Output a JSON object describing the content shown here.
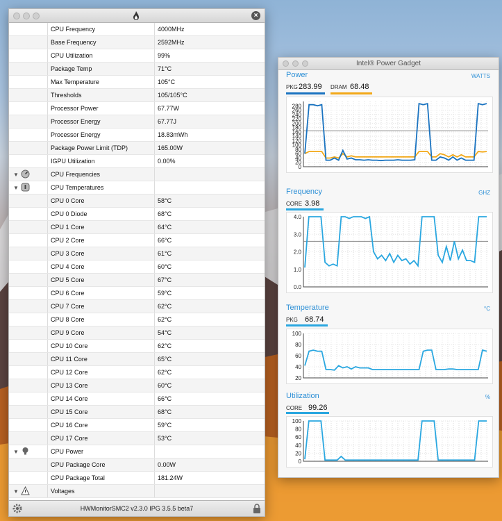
{
  "hwmonitor": {
    "footer": "HWMonitorSMC2 v2.3.0 IPG 3.5.5 beta7",
    "rows": [
      {
        "type": "item",
        "name": "CPU Frequency",
        "value": "4000MHz"
      },
      {
        "type": "item",
        "name": "Base Frequency",
        "value": "2592MHz"
      },
      {
        "type": "item",
        "name": "CPU Utilization",
        "value": "99%"
      },
      {
        "type": "item",
        "name": "Package Temp",
        "value": "71°C"
      },
      {
        "type": "item",
        "name": "Max Temperature",
        "value": "105°C"
      },
      {
        "type": "item",
        "name": "Thresholds",
        "value": "105/105°C"
      },
      {
        "type": "item",
        "name": "Processor Power",
        "value": "67.77W"
      },
      {
        "type": "item",
        "name": "Processor Energy",
        "value": "67.77J"
      },
      {
        "type": "item",
        "name": "Processor Energy",
        "value": "18.83mWh"
      },
      {
        "type": "item",
        "name": "Package Power Limit (TDP)",
        "value": "165.00W"
      },
      {
        "type": "item",
        "name": "IGPU Utilization",
        "value": "0.00%"
      },
      {
        "type": "group",
        "name": "CPU Frequencies",
        "value": "",
        "icon": "gauge-icon"
      },
      {
        "type": "group",
        "name": "CPU Temperatures",
        "value": "",
        "icon": "thermometer-icon"
      },
      {
        "type": "item",
        "name": "CPU 0 Core",
        "value": "58°C"
      },
      {
        "type": "item",
        "name": "CPU 0 Diode",
        "value": "68°C"
      },
      {
        "type": "item",
        "name": "CPU 1 Core",
        "value": "64°C"
      },
      {
        "type": "item",
        "name": "CPU 2 Core",
        "value": "66°C"
      },
      {
        "type": "item",
        "name": "CPU 3 Core",
        "value": "61°C"
      },
      {
        "type": "item",
        "name": "CPU 4 Core",
        "value": "60°C"
      },
      {
        "type": "item",
        "name": "CPU 5 Core",
        "value": "67°C"
      },
      {
        "type": "item",
        "name": "CPU 6 Core",
        "value": "59°C"
      },
      {
        "type": "item",
        "name": "CPU 7 Core",
        "value": "62°C"
      },
      {
        "type": "item",
        "name": "CPU 8 Core",
        "value": "62°C"
      },
      {
        "type": "item",
        "name": "CPU 9 Core",
        "value": "54°C"
      },
      {
        "type": "item",
        "name": "CPU 10 Core",
        "value": "62°C"
      },
      {
        "type": "item",
        "name": "CPU 11 Core",
        "value": "65°C"
      },
      {
        "type": "item",
        "name": "CPU 12 Core",
        "value": "62°C"
      },
      {
        "type": "item",
        "name": "CPU 13 Core",
        "value": "60°C"
      },
      {
        "type": "item",
        "name": "CPU 14 Core",
        "value": "66°C"
      },
      {
        "type": "item",
        "name": "CPU 15 Core",
        "value": "68°C"
      },
      {
        "type": "item",
        "name": "CPU 16 Core",
        "value": "59°C"
      },
      {
        "type": "item",
        "name": "CPU 17 Core",
        "value": "53°C"
      },
      {
        "type": "group",
        "name": "CPU Power",
        "value": "",
        "icon": "lightbulb-icon"
      },
      {
        "type": "item",
        "name": "CPU Package Core",
        "value": "0.00W"
      },
      {
        "type": "item",
        "name": "CPU Package Total",
        "value": "181.24W"
      },
      {
        "type": "group",
        "name": "Voltages",
        "value": "",
        "icon": "warning-icon"
      }
    ]
  },
  "ipg": {
    "title": "Intel® Power Gadget",
    "power": {
      "title": "Power",
      "unit": "WATTS",
      "pkg_label": "PKG",
      "pkg_value": "283.99",
      "dram_label": "DRAM",
      "dram_value": "68.48",
      "pkg_color": "#1a73c0",
      "dram_color": "#f2a818"
    },
    "frequency": {
      "title": "Frequency",
      "unit": "GHZ",
      "core_label": "CORE",
      "core_value": "3.98",
      "color": "#2aa7e0"
    },
    "temperature": {
      "title": "Temperature",
      "unit": "°C",
      "pkg_label": "PKG",
      "pkg_value": "68.74",
      "color": "#2aa7e0"
    },
    "utilization": {
      "title": "Utilization",
      "unit": "%",
      "core_label": "CORE",
      "core_value": "99.26",
      "color": "#2aa7e0"
    }
  },
  "chart_data": [
    {
      "type": "line",
      "title": "Power",
      "yticks": [
        "280",
        "260",
        "240",
        "220",
        "200",
        "180",
        "160",
        "140",
        "120",
        "100",
        "80",
        "60",
        "40",
        "20",
        "0"
      ],
      "ylim": [
        0,
        300
      ],
      "threshold": 165,
      "series": [
        {
          "name": "PKG",
          "values": [
            60,
            285,
            285,
            280,
            285,
            30,
            30,
            40,
            30,
            75,
            35,
            40,
            32,
            32,
            30,
            32,
            30,
            30,
            28,
            30,
            30,
            30,
            32,
            30,
            30,
            30,
            32,
            290,
            285,
            290,
            30,
            30,
            45,
            40,
            30,
            45,
            30,
            40,
            30,
            30,
            30,
            290,
            285,
            290
          ]
        },
        {
          "name": "DRAM",
          "values": [
            60,
            70,
            70,
            70,
            70,
            40,
            40,
            45,
            40,
            60,
            45,
            50,
            45,
            45,
            45,
            45,
            45,
            45,
            45,
            45,
            45,
            45,
            45,
            45,
            45,
            45,
            45,
            70,
            70,
            70,
            45,
            45,
            60,
            55,
            45,
            55,
            45,
            55,
            45,
            45,
            45,
            70,
            68,
            70
          ]
        }
      ]
    },
    {
      "type": "line",
      "title": "Frequency",
      "yticks": [
        "4.0",
        "3.0",
        "2.0",
        "1.0",
        "0.0"
      ],
      "ylim": [
        0,
        4
      ],
      "threshold": 2.6,
      "series": [
        {
          "name": "CORE",
          "values": [
            1.1,
            4.0,
            4.0,
            4.0,
            4.0,
            1.4,
            1.2,
            1.3,
            1.2,
            4.0,
            4.0,
            3.9,
            4.0,
            4.0,
            4.0,
            3.9,
            4.0,
            2.0,
            1.6,
            1.8,
            1.5,
            1.9,
            1.4,
            1.8,
            1.5,
            1.6,
            1.3,
            1.5,
            1.2,
            4.0,
            4.0,
            4.0,
            4.0,
            1.8,
            1.4,
            2.3,
            1.5,
            2.6,
            1.6,
            2.1,
            1.5,
            1.5,
            1.4,
            4.0,
            4.0,
            4.0
          ]
        }
      ]
    },
    {
      "type": "line",
      "title": "Temperature",
      "yticks": [
        "100",
        "80",
        "60",
        "40",
        "20"
      ],
      "ylim": [
        20,
        100
      ],
      "series": [
        {
          "name": "PKG",
          "values": [
            42,
            68,
            70,
            68,
            68,
            35,
            35,
            34,
            42,
            38,
            40,
            36,
            40,
            38,
            38,
            38,
            35,
            35,
            35,
            35,
            35,
            35,
            35,
            35,
            35,
            35,
            35,
            35,
            68,
            70,
            70,
            35,
            35,
            35,
            36,
            36,
            35,
            35,
            35,
            35,
            35,
            35,
            70,
            68
          ]
        }
      ]
    },
    {
      "type": "line",
      "title": "Utilization",
      "yticks": [
        "100",
        "80",
        "60",
        "40",
        "20",
        "0"
      ],
      "ylim": [
        0,
        100
      ],
      "series": [
        {
          "name": "CORE",
          "values": [
            5,
            100,
            100,
            100,
            100,
            3,
            3,
            3,
            3,
            12,
            3,
            3,
            3,
            3,
            3,
            3,
            3,
            3,
            3,
            3,
            3,
            3,
            3,
            3,
            3,
            3,
            3,
            3,
            3,
            100,
            100,
            100,
            100,
            3,
            3,
            3,
            3,
            3,
            3,
            3,
            3,
            3,
            3,
            100,
            100,
            100
          ]
        }
      ]
    }
  ]
}
